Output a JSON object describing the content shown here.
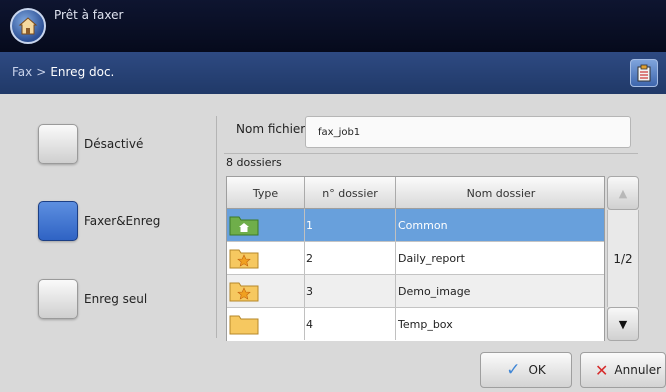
{
  "status": {
    "title": "Prêt à faxer"
  },
  "nav": {
    "crumbs": [
      "Fax",
      "Enreg doc."
    ],
    "separator": ">"
  },
  "modes": [
    {
      "label": "Désactivé",
      "selected": false
    },
    {
      "label": "Faxer&Enreg",
      "selected": true
    },
    {
      "label": "Enreg seul",
      "selected": false
    }
  ],
  "filename": {
    "label": "Nom fichier:",
    "value": "fax_job1"
  },
  "folder_count": "8 dossiers",
  "table": {
    "headers": [
      "Type",
      "n° dossier",
      "Nom dossier"
    ],
    "rows": [
      {
        "icon": "home-folder-icon",
        "num": "1",
        "name": "Common",
        "selected": true
      },
      {
        "icon": "star-folder-icon",
        "num": "2",
        "name": "Daily_report",
        "selected": false
      },
      {
        "icon": "star-folder-icon",
        "num": "3",
        "name": "Demo_image",
        "selected": false
      },
      {
        "icon": "folder-icon",
        "num": "4",
        "name": "Temp_box",
        "selected": false
      }
    ]
  },
  "pager": {
    "page": "1/2"
  },
  "actions": {
    "ok": "OK",
    "cancel": "Annuler"
  },
  "colors": {
    "selection": "#68a0dc",
    "header_bar": "#0e1530",
    "nav_bar": "#2e4a82"
  }
}
